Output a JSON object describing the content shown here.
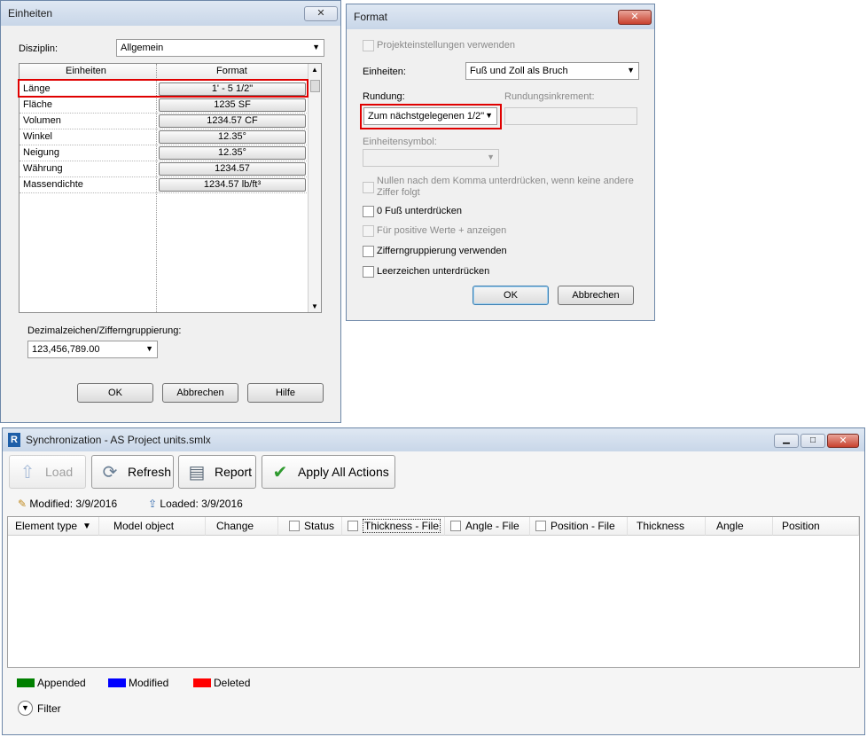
{
  "einheiten": {
    "title": "Einheiten",
    "close": "✕",
    "disziplin_label": "Disziplin:",
    "disziplin_value": "Allgemein",
    "col_einheiten": "Einheiten",
    "col_format": "Format",
    "rows": [
      {
        "name": "Länge",
        "format": "1' - 5 1/2\""
      },
      {
        "name": "Fläche",
        "format": "1235 SF"
      },
      {
        "name": "Volumen",
        "format": "1234.57 CF"
      },
      {
        "name": "Winkel",
        "format": "12.35°"
      },
      {
        "name": "Neigung",
        "format": "12.35°"
      },
      {
        "name": "Währung",
        "format": "1234.57"
      },
      {
        "name": "Massendichte",
        "format": "1234.57 lb/ft³"
      }
    ],
    "decimal_label": "Dezimalzeichen/Zifferngruppierung:",
    "decimal_value": "123,456,789.00",
    "ok": "OK",
    "abbrechen": "Abbrechen",
    "hilfe": "Hilfe"
  },
  "format": {
    "title": "Format",
    "close": "✕",
    "projekt_label": "Projekteinstellungen verwenden",
    "einheiten_label": "Einheiten:",
    "einheiten_value": "Fuß und Zoll als Bruch",
    "rundung_label": "Rundung:",
    "rundungsinkrement_label": "Rundungsinkrement:",
    "rundung_value": "Zum nächstgelegenen 1/2\"",
    "symbol_label": "Einheitensymbol:",
    "nullen_label_1": "Nullen nach dem Komma unterdrücken, wenn keine andere",
    "nullen_label_2": "Ziffer folgt",
    "null_fuss_label": "0 Fuß unterdrücken",
    "positive_label": "Für positive Werte + anzeigen",
    "gruppierung_label": "Zifferngruppierung verwenden",
    "leerzeichen_label": "Leerzeichen unterdrücken",
    "ok": "OK",
    "abbrechen": "Abbrechen"
  },
  "sync": {
    "title": "Synchronization - AS Project units.smlx",
    "app_icon": "R",
    "toolbar": {
      "load": "Load",
      "refresh": "Refresh",
      "report": "Report",
      "apply": "Apply All Actions"
    },
    "modified": "Modified: 3/9/2016",
    "loaded": "Loaded: 3/9/2016",
    "columns": [
      "Element type",
      "Model object",
      "Change",
      "Status",
      "Thickness - File",
      "Angle - File",
      "Position - File",
      "Thickness",
      "Angle",
      "Position"
    ],
    "legend": [
      {
        "label": "Appended",
        "color": "#008000"
      },
      {
        "label": "Modified",
        "color": "#0000ff"
      },
      {
        "label": "Deleted",
        "color": "#ff0000"
      }
    ],
    "filter": "Filter"
  }
}
